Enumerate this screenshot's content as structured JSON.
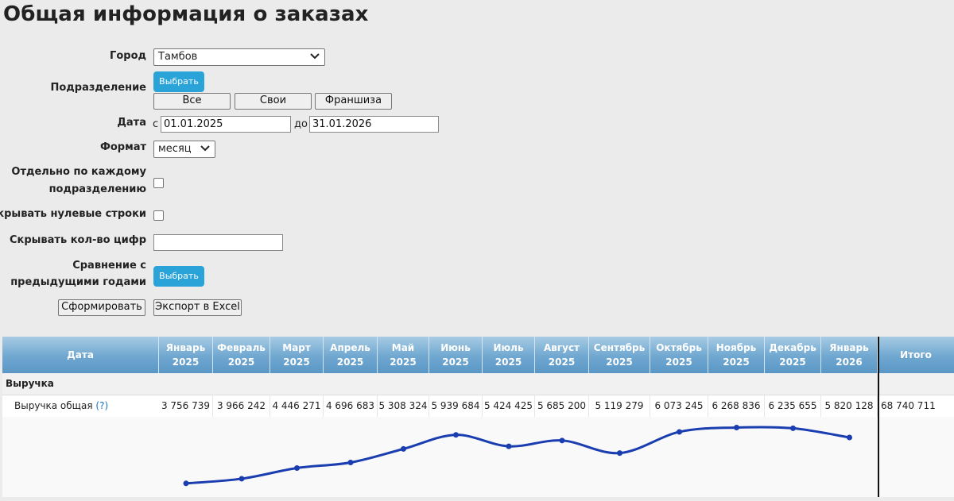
{
  "page": {
    "title": "Общая информация о заказах"
  },
  "form": {
    "city": {
      "label": "Город",
      "value": "Тамбов"
    },
    "division": {
      "label": "Подразделение",
      "choose_label": "Выбрать",
      "buttons": [
        "Все",
        "Свои",
        "Франшиза"
      ]
    },
    "date": {
      "label": "Дата",
      "from_prefix": "с",
      "from_value": "01.01.2025",
      "to_prefix": "до",
      "to_value": "31.01.2026"
    },
    "format": {
      "label": "Формат",
      "value": "месяц"
    },
    "separate": {
      "label_line1": "Отдельно по каждому",
      "label_line2": "подразделению",
      "checked": false
    },
    "hide_zero": {
      "label": "Скрывать нулевые строки",
      "checked": false
    },
    "hide_digits": {
      "label": "Скрывать кол-во цифр",
      "value": ""
    },
    "compare": {
      "label_line1": "Сравнение с",
      "label_line2": "предыдущими годами",
      "choose_label": "Выбрать"
    },
    "submit_label": "Сформировать",
    "export_label": "Экспорт в Excel"
  },
  "table": {
    "date_header": "Дата",
    "months": [
      {
        "m": "Январь",
        "y": "2025"
      },
      {
        "m": "Февраль",
        "y": "2025"
      },
      {
        "m": "Март",
        "y": "2025"
      },
      {
        "m": "Апрель",
        "y": "2025"
      },
      {
        "m": "Май",
        "y": "2025"
      },
      {
        "m": "Июнь",
        "y": "2025"
      },
      {
        "m": "Июль",
        "y": "2025"
      },
      {
        "m": "Август",
        "y": "2025"
      },
      {
        "m": "Сентябрь",
        "y": "2025"
      },
      {
        "m": "Октябрь",
        "y": "2025"
      },
      {
        "m": "Ноябрь",
        "y": "2025"
      },
      {
        "m": "Декабрь",
        "y": "2025"
      },
      {
        "m": "Январь",
        "y": "2026"
      }
    ],
    "total_header": "Итого",
    "section_name": "Выручка",
    "row_name": "Выручка общая",
    "row_help": "(?)",
    "values": [
      "3 756 739",
      "3 966 242",
      "4 446 271",
      "4 696 683",
      "5 308 324",
      "5 939 684",
      "5 424 425",
      "5 685 200",
      "5 119 279",
      "6 073 245",
      "6 268 836",
      "6 235 655",
      "5 820 128"
    ],
    "total": "68 740 711"
  },
  "chart_data": {
    "type": "line",
    "x": [
      "Январь 2025",
      "Февраль 2025",
      "Март 2025",
      "Апрель 2025",
      "Май 2025",
      "Июнь 2025",
      "Июль 2025",
      "Август 2025",
      "Сентябрь 2025",
      "Октябрь 2025",
      "Ноябрь 2025",
      "Декабрь 2025",
      "Январь 2026"
    ],
    "series": [
      {
        "values": [
          3756739,
          3966242,
          4446271,
          4696683,
          5308324,
          5939684,
          5424425,
          5685200,
          5119279,
          6073245,
          6268836,
          6235655,
          5820128
        ]
      }
    ],
    "color": "#1a3db0",
    "grid": false
  },
  "colors": {
    "accent": "#2aa3d8",
    "header_top": "#a7cbe4",
    "header_bottom": "#5b97c6",
    "line": "#1a3db0"
  }
}
